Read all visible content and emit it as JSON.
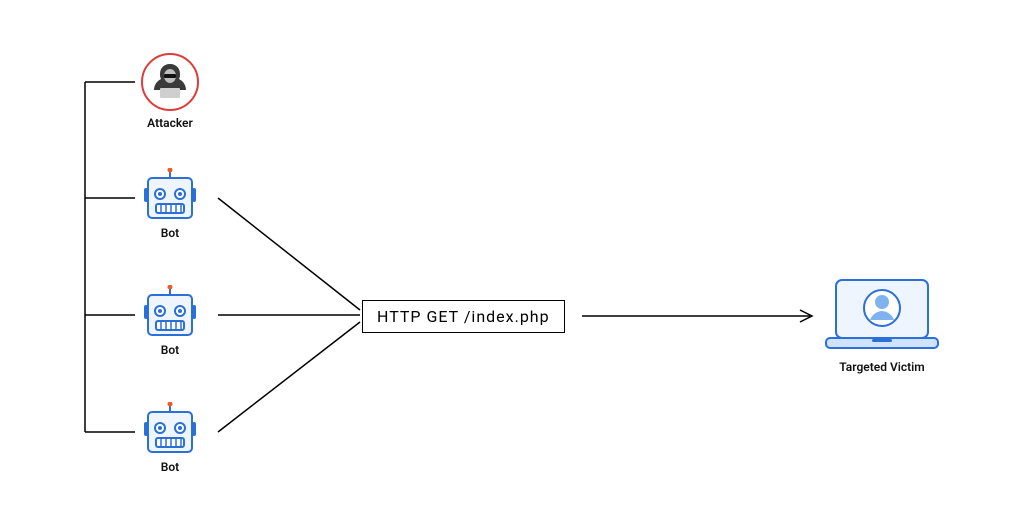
{
  "attacker": {
    "label": "Attacker"
  },
  "bots": [
    {
      "label": "Bot"
    },
    {
      "label": "Bot"
    },
    {
      "label": "Bot"
    }
  ],
  "request": {
    "text": "HTTP GET /index.php"
  },
  "victim": {
    "label": "Targeted Victim"
  },
  "colors": {
    "attacker_ring": "#e03a3a",
    "bot_blue": "#2b6fd8",
    "bot_fill": "#eef5ff",
    "bot_accent": "#f15a24",
    "victim_blue": "#cfe3ff",
    "victim_stroke": "#2b6fd8"
  }
}
